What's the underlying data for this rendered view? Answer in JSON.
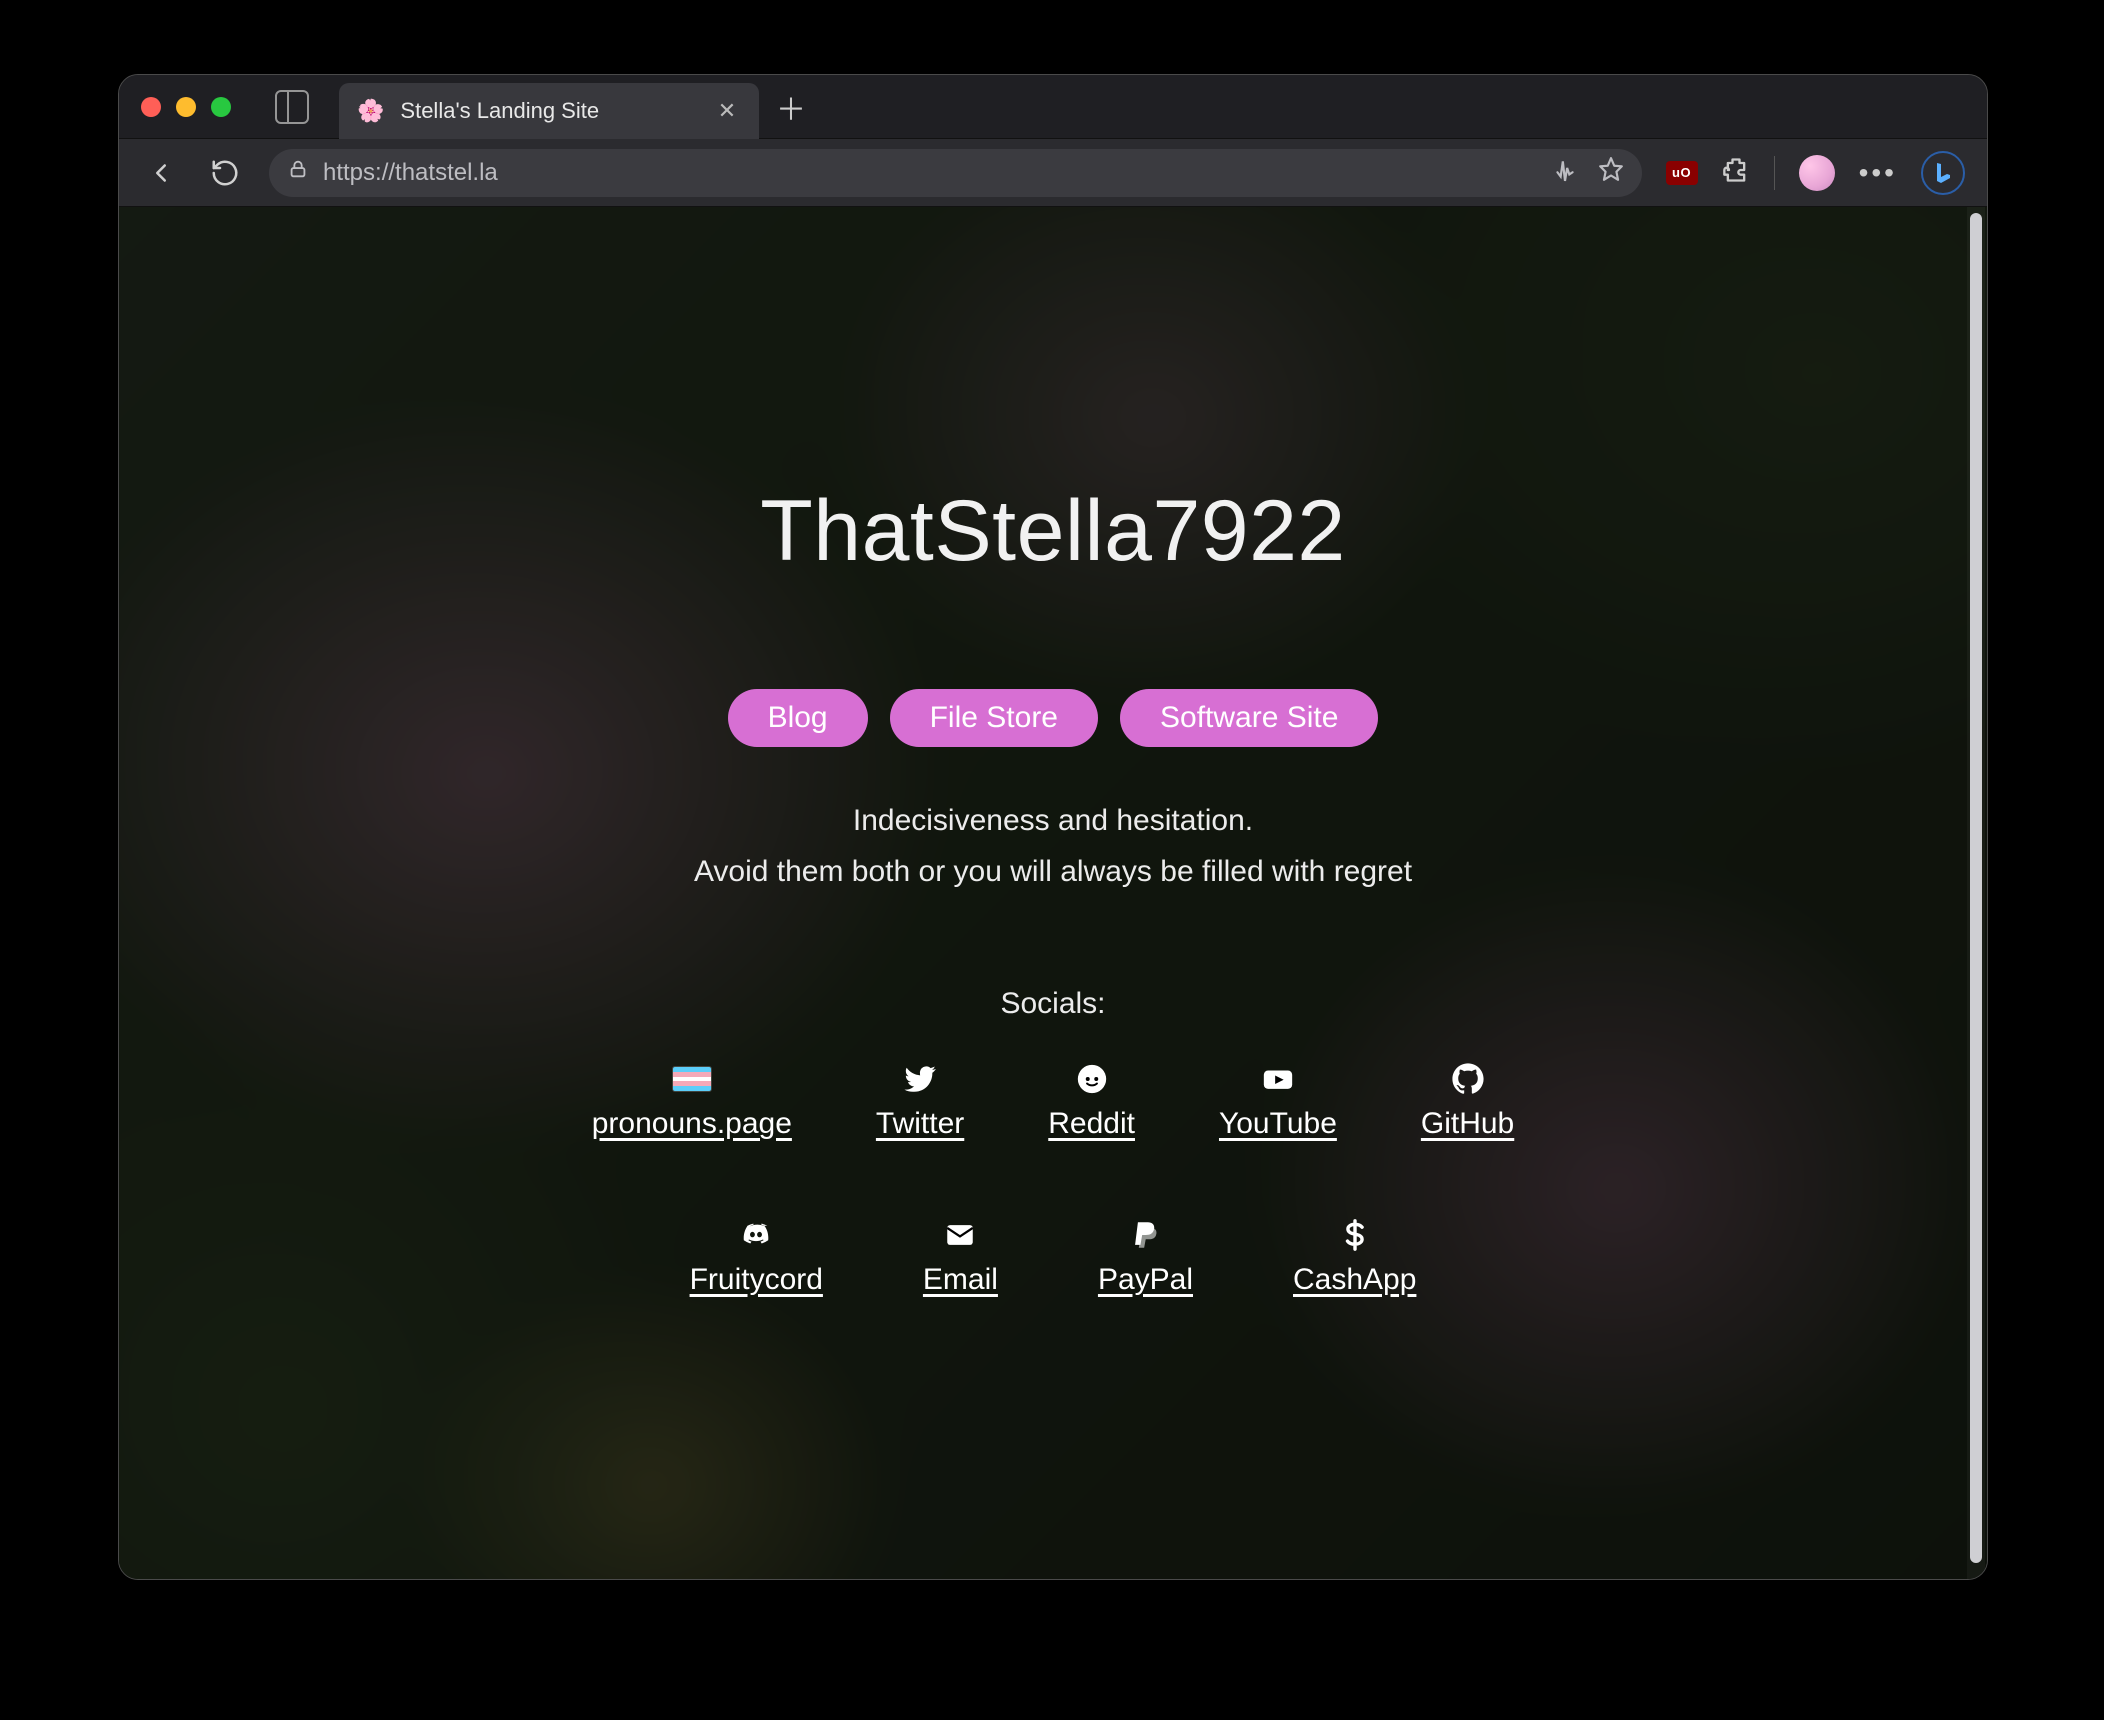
{
  "browser": {
    "tab": {
      "favicon": "🌸",
      "title": "Stella's Landing Site"
    },
    "address_url": "https://thatstel.la",
    "ublock_label": "uO"
  },
  "page": {
    "title": "ThatStella7922",
    "nav_buttons": [
      {
        "label": "Blog"
      },
      {
        "label": "File Store"
      },
      {
        "label": "Software Site"
      }
    ],
    "tagline_line1": "Indecisiveness and hesitation.",
    "tagline_line2": "Avoid them both or you will always be filled with regret",
    "socials_heading": "Socials:",
    "socials_row1": [
      {
        "label": "pronouns.page",
        "icon": "transflag"
      },
      {
        "label": "Twitter",
        "icon": "twitter"
      },
      {
        "label": "Reddit",
        "icon": "reddit"
      },
      {
        "label": "YouTube",
        "icon": "youtube"
      },
      {
        "label": "GitHub",
        "icon": "github"
      }
    ],
    "socials_row2": [
      {
        "label": "Fruitycord",
        "icon": "discord"
      },
      {
        "label": "Email",
        "icon": "email"
      },
      {
        "label": "PayPal",
        "icon": "paypal"
      },
      {
        "label": "CashApp",
        "icon": "dollar"
      }
    ]
  }
}
